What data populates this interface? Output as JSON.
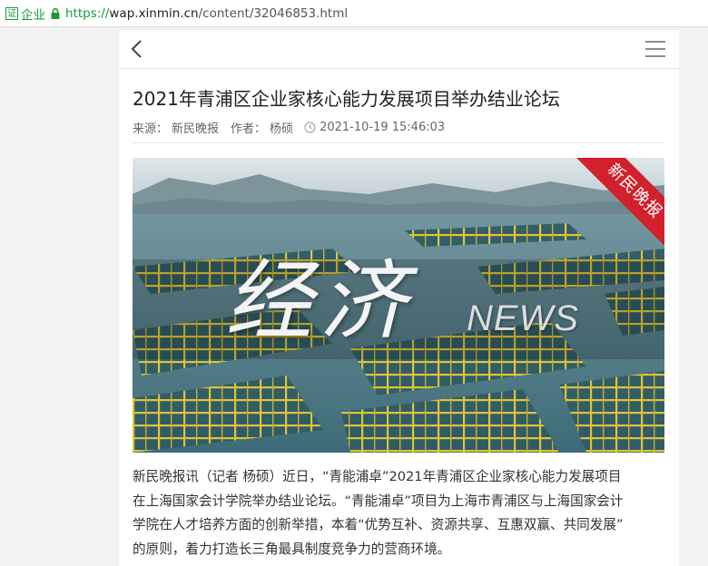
{
  "browser": {
    "cert_icon_text": "证",
    "cert_label": "企业",
    "url_scheme": "https://",
    "url_host": "wap.xinmin.cn",
    "url_path": "/content/32046853.html"
  },
  "nav": {
    "back_icon": "chevron-left-icon",
    "menu_icon": "hamburger-menu-icon"
  },
  "article": {
    "title": "2021年青浦区企业家核心能力发展项目举办结业论坛",
    "source_label": "来源：",
    "source": "新民晚报",
    "author_label": "作者：",
    "author": "杨硕",
    "datetime": "2021-10-19 15:46:03",
    "hero": {
      "badge_text": "新民晚报",
      "title_cn": "经济",
      "title_en": "NEWS"
    },
    "body_lines": [
      "新民晚报讯（记者 杨硕）近日，“青能浦卓”2021年青浦区企业家核心能力发展项目",
      "在上海国家会计学院举办结业论坛。“青能浦卓”项目为上海市青浦区与上海国家会计",
      "学院在人才培养方面的创新举措，本着“优势互补、资源共享、互惠双赢、共同发展”",
      "的原则，着力打造长三角最具制度竞争力的营商环境。"
    ]
  },
  "colors": {
    "secure_green": "#1a9a3a",
    "badge_red": "#d2202c"
  }
}
